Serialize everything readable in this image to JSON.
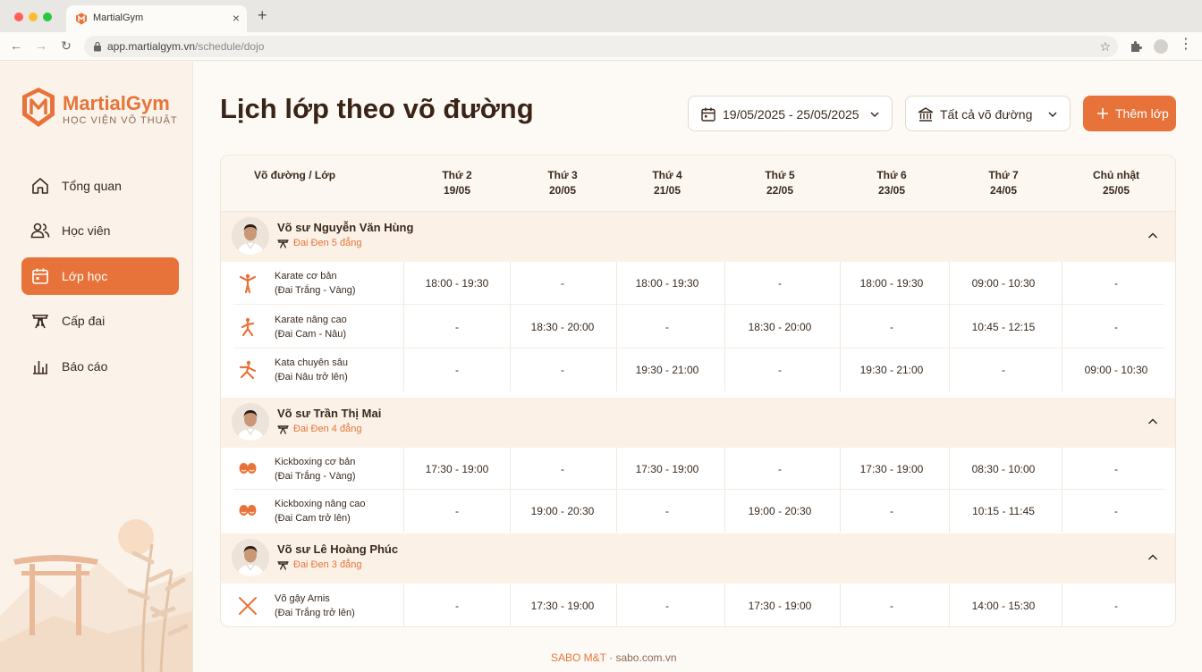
{
  "browser": {
    "tab_title": "MartialGym",
    "url_host": "app.martialgym.vn",
    "url_path": "/schedule/dojo"
  },
  "brand": {
    "name": "MartialGym",
    "subtitle": "HỌC VIỆN VÕ THUẬT",
    "accent_color": "#e8733a"
  },
  "sidebar": {
    "items": [
      {
        "label": "Tổng quan",
        "icon": "home-icon",
        "active": false
      },
      {
        "label": "Học viên",
        "icon": "users-icon",
        "active": false
      },
      {
        "label": "Lớp học",
        "icon": "calendar-icon",
        "active": true
      },
      {
        "label": "Cấp đai",
        "icon": "belt-icon",
        "active": false
      },
      {
        "label": "Báo cáo",
        "icon": "chart-icon",
        "active": false
      }
    ]
  },
  "header": {
    "title": "Lịch lớp theo võ đường",
    "date_range": "19/05/2025 - 25/05/2025",
    "dojo_filter": "Tất cả võ đường",
    "add_button": "Thêm lớp"
  },
  "table": {
    "first_col": "Võ đường / Lớp",
    "days": [
      {
        "name": "Thứ 2",
        "date": "19/05"
      },
      {
        "name": "Thứ 3",
        "date": "20/05"
      },
      {
        "name": "Thứ 4",
        "date": "21/05"
      },
      {
        "name": "Thứ 5",
        "date": "22/05"
      },
      {
        "name": "Thứ 6",
        "date": "23/05"
      },
      {
        "name": "Thứ 7",
        "date": "24/05"
      },
      {
        "name": "Chủ nhật",
        "date": "25/05"
      }
    ],
    "groups": [
      {
        "master": "Võ sư Nguyễn Văn Hùng",
        "belt": "Đai Đen 5 đẳng",
        "classes": [
          {
            "name": "Karate cơ bản",
            "level": "(Đai Trắng - Vàng)",
            "icon": "karate-kick-icon",
            "slots": [
              "18:00 - 19:30",
              "-",
              "18:00 - 19:30",
              "-",
              "18:00 - 19:30",
              "09:00 - 10:30",
              "-"
            ]
          },
          {
            "name": "Karate nâng cao",
            "level": "(Đai Cam - Nâu)",
            "icon": "karate-stance-icon",
            "slots": [
              "-",
              "18:30 - 20:00",
              "-",
              "18:30 - 20:00",
              "-",
              "10:45 - 12:15",
              "-"
            ]
          },
          {
            "name": "Kata chuyên sâu",
            "level": "(Đai Nâu trở lên)",
            "icon": "kata-icon",
            "slots": [
              "-",
              "-",
              "19:30 - 21:00",
              "-",
              "19:30 - 21:00",
              "-",
              "09:00 - 10:30"
            ]
          }
        ]
      },
      {
        "master": "Võ sư Trần Thị Mai",
        "belt": "Đai Đen 4 đẳng",
        "classes": [
          {
            "name": "Kickboxing cơ bản",
            "level": "(Đai Trắng - Vàng)",
            "icon": "boxing-gloves-icon",
            "slots": [
              "17:30 - 19:00",
              "-",
              "17:30 - 19:00",
              "-",
              "17:30 - 19:00",
              "08:30 - 10:00",
              "-"
            ]
          },
          {
            "name": "Kickboxing nâng cao",
            "level": "(Đai Cam trở lên)",
            "icon": "boxing-gloves-icon",
            "slots": [
              "-",
              "19:00 - 20:30",
              "-",
              "19:00 - 20:30",
              "-",
              "10:15 - 11:45",
              "-"
            ]
          }
        ]
      },
      {
        "master": "Võ sư Lê Hoàng Phúc",
        "belt": "Đai Đen 3 đẳng",
        "classes": [
          {
            "name": "Võ gậy Arnis",
            "level": "(Đai Trắng trở lên)",
            "icon": "crossed-sticks-icon",
            "slots": [
              "-",
              "17:30 - 19:00",
              "-",
              "17:30 - 19:00",
              "-",
              "14:00 - 15:30",
              "-"
            ]
          }
        ]
      }
    ]
  },
  "footer": {
    "brand": "SABO M&T",
    "rest": " · sabo.com.vn"
  }
}
